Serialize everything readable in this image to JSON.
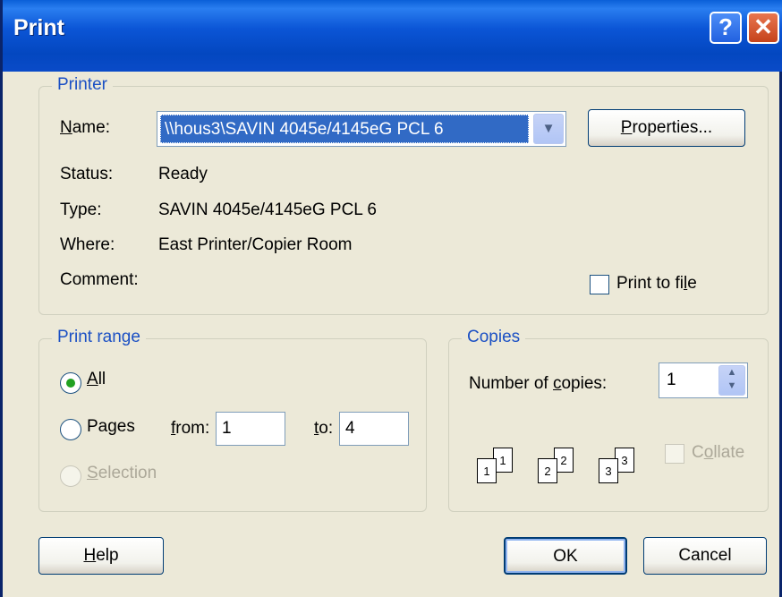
{
  "window": {
    "title": "Print",
    "help_glyph": "?",
    "close_glyph": "✕"
  },
  "printer": {
    "group_title": "Printer",
    "name_label_u": "N",
    "name_label_rest": "ame:",
    "name_value": "\\\\hous3\\SAVIN 4045e/4145eG PCL 6",
    "properties_u": "P",
    "properties_rest": "roperties...",
    "status_label": "Status:",
    "status_value": "Ready",
    "type_label": "Type:",
    "type_value": "SAVIN 4045e/4145eG PCL 6",
    "where_label": "Where:",
    "where_value": "East Printer/Copier Room",
    "comment_label": "Comment:",
    "print_to_file_pre": "Print to fi",
    "print_to_file_u": "l",
    "print_to_file_post": "e",
    "print_to_file_checked": false
  },
  "print_range": {
    "group_title": "Print range",
    "all_u": "A",
    "all_rest": "ll",
    "all_selected": true,
    "pages_label": "Pages",
    "from_u": "f",
    "from_rest": "rom:",
    "from_value": "1",
    "to_u": "t",
    "to_rest": "o:",
    "to_value": "4",
    "selection_u": "S",
    "selection_rest": "election"
  },
  "copies": {
    "group_title": "Copies",
    "number_label_pre": "Number of ",
    "number_label_u": "c",
    "number_label_post": "opies:",
    "number_value": "1",
    "collate_pre": "C",
    "collate_u": "o",
    "collate_post": "llate",
    "collate_checked": false,
    "pages": [
      "1",
      "1",
      "2",
      "2",
      "3",
      "3"
    ]
  },
  "buttons": {
    "help_u": "H",
    "help_rest": "elp",
    "ok": "OK",
    "cancel": "Cancel"
  }
}
